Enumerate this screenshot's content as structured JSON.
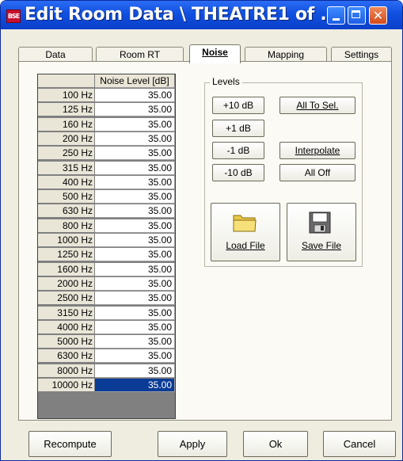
{
  "window": {
    "app_icon": "BSE",
    "title": "Edit Room Data \\ THEATRE1 of ...",
    "controls": [
      "minimize-icon",
      "maximize-icon",
      "close-icon"
    ],
    "close_glyph": "✕"
  },
  "tabs": [
    {
      "label": "Data"
    },
    {
      "label": "Room RT"
    },
    {
      "label": "Noise",
      "active": true
    },
    {
      "label": "Mapping"
    },
    {
      "label": "Settings"
    }
  ],
  "grid": {
    "column_header": "Noise Level [dB]",
    "rows": [
      {
        "freq": "100 Hz",
        "value": "35.00"
      },
      {
        "freq": "125 Hz",
        "value": "35.00"
      },
      {
        "freq": "160 Hz",
        "value": "35.00"
      },
      {
        "freq": "200 Hz",
        "value": "35.00"
      },
      {
        "freq": "250 Hz",
        "value": "35.00"
      },
      {
        "freq": "315 Hz",
        "value": "35.00"
      },
      {
        "freq": "400 Hz",
        "value": "35.00"
      },
      {
        "freq": "500 Hz",
        "value": "35.00"
      },
      {
        "freq": "630 Hz",
        "value": "35.00"
      },
      {
        "freq": "800 Hz",
        "value": "35.00"
      },
      {
        "freq": "1000 Hz",
        "value": "35.00"
      },
      {
        "freq": "1250 Hz",
        "value": "35.00"
      },
      {
        "freq": "1600 Hz",
        "value": "35.00"
      },
      {
        "freq": "2000 Hz",
        "value": "35.00"
      },
      {
        "freq": "2500 Hz",
        "value": "35.00"
      },
      {
        "freq": "3150 Hz",
        "value": "35.00"
      },
      {
        "freq": "4000 Hz",
        "value": "35.00"
      },
      {
        "freq": "5000 Hz",
        "value": "35.00"
      },
      {
        "freq": "6300 Hz",
        "value": "35.00"
      },
      {
        "freq": "8000 Hz",
        "value": "35.00"
      },
      {
        "freq": "10000 Hz",
        "value": "35.00",
        "selected": true
      }
    ]
  },
  "levels": {
    "group_label": "Levels",
    "plus10": "+10 dB",
    "plus1": "+1 dB",
    "minus1": "-1 dB",
    "minus10": "-10 dB",
    "all_to_sel": "All To Sel.",
    "interpolate": "Interpolate",
    "all_off": "All Off",
    "load_file": "Load File",
    "save_file": "Save File",
    "load_icon": "folder-icon",
    "save_icon": "floppy-disk-icon"
  },
  "footer": {
    "recompute": "Recompute",
    "apply": "Apply",
    "ok": "Ok",
    "cancel": "Cancel"
  },
  "colors": {
    "titlebar": "#1150e0",
    "close_button": "#d44a1d",
    "selected_cell": "#0a3c96"
  }
}
